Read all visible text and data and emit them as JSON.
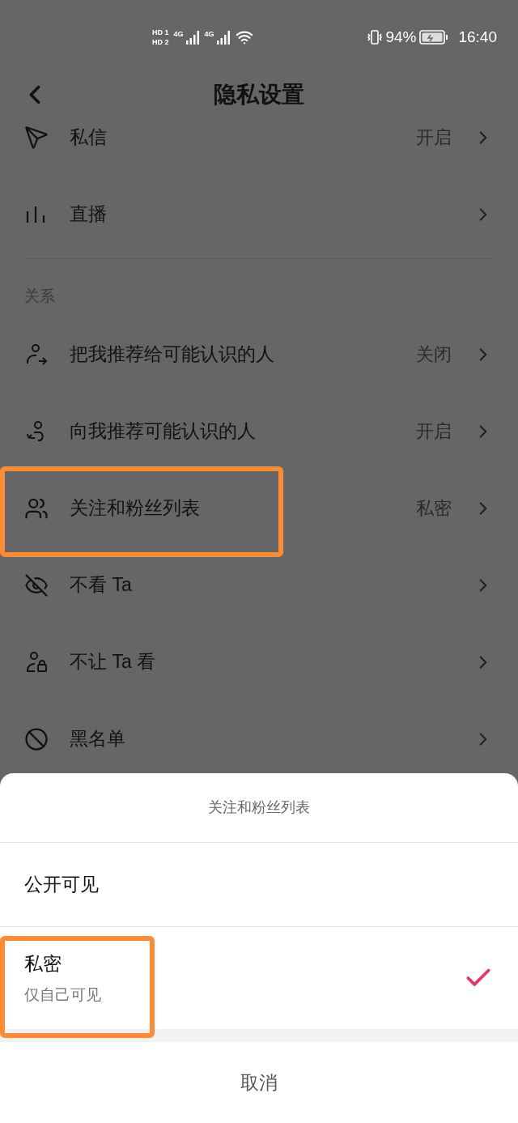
{
  "status_bar": {
    "sims": [
      {
        "label": "HD",
        "slot": "1",
        "network": "4G"
      },
      {
        "label": "HD",
        "slot": "2",
        "network": "4G"
      }
    ],
    "battery": "94%",
    "time": "16:40"
  },
  "header": {
    "title": "隐私设置"
  },
  "rows": [
    {
      "kind": "message",
      "label": "私信",
      "value": "开启",
      "highlighted": false
    },
    {
      "kind": "live",
      "label": "直播",
      "highlighted": false
    }
  ],
  "section": {
    "label": "关系",
    "rows": [
      {
        "kind": "recommend-out",
        "label": "把我推荐给可能认识的人",
        "value": "关闭",
        "highlighted": false
      },
      {
        "kind": "recommend-in",
        "label": "向我推荐可能认识的人",
        "value": "开启",
        "highlighted": false
      },
      {
        "kind": "follows",
        "label": "关注和粉丝列表",
        "value": "私密",
        "highlighted": true
      },
      {
        "kind": "hide",
        "label": "不看 Ta",
        "highlighted": false
      },
      {
        "kind": "block-view",
        "label": "不让 Ta 看",
        "highlighted": false
      },
      {
        "kind": "blacklist",
        "label": "黑名单",
        "highlighted": false
      }
    ]
  },
  "sheet": {
    "title": "关注和粉丝列表",
    "options": [
      {
        "label": "公开可见",
        "selected": false,
        "highlighted": false
      },
      {
        "label": "私密",
        "sublabel": "仅自己可见",
        "selected": true,
        "highlighted": true
      }
    ],
    "cancel": "取消"
  }
}
